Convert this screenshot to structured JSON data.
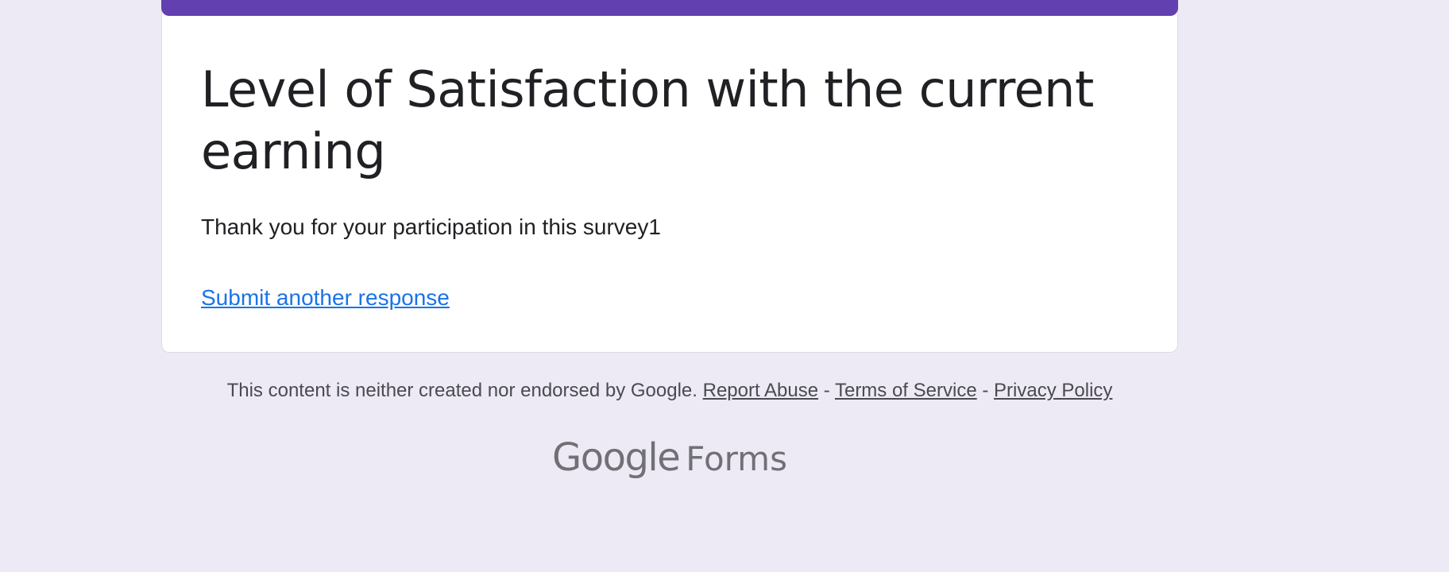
{
  "form": {
    "title": "Level of Satisfaction with the current earning",
    "confirmation_message": "Thank you for your participation in this survey1",
    "submit_another_label": "Submit another response",
    "accent_color": "#6240B0"
  },
  "footer": {
    "disclaimer": "This content is neither created nor endorsed by Google.",
    "report_abuse": "Report Abuse",
    "separator": "-",
    "terms": "Terms of Service",
    "privacy": "Privacy Policy"
  },
  "brand": {
    "google": "Google",
    "product": "Forms"
  },
  "colors": {
    "background": "#EDEAF6",
    "link": "#1a73e8",
    "text": "#202124"
  }
}
